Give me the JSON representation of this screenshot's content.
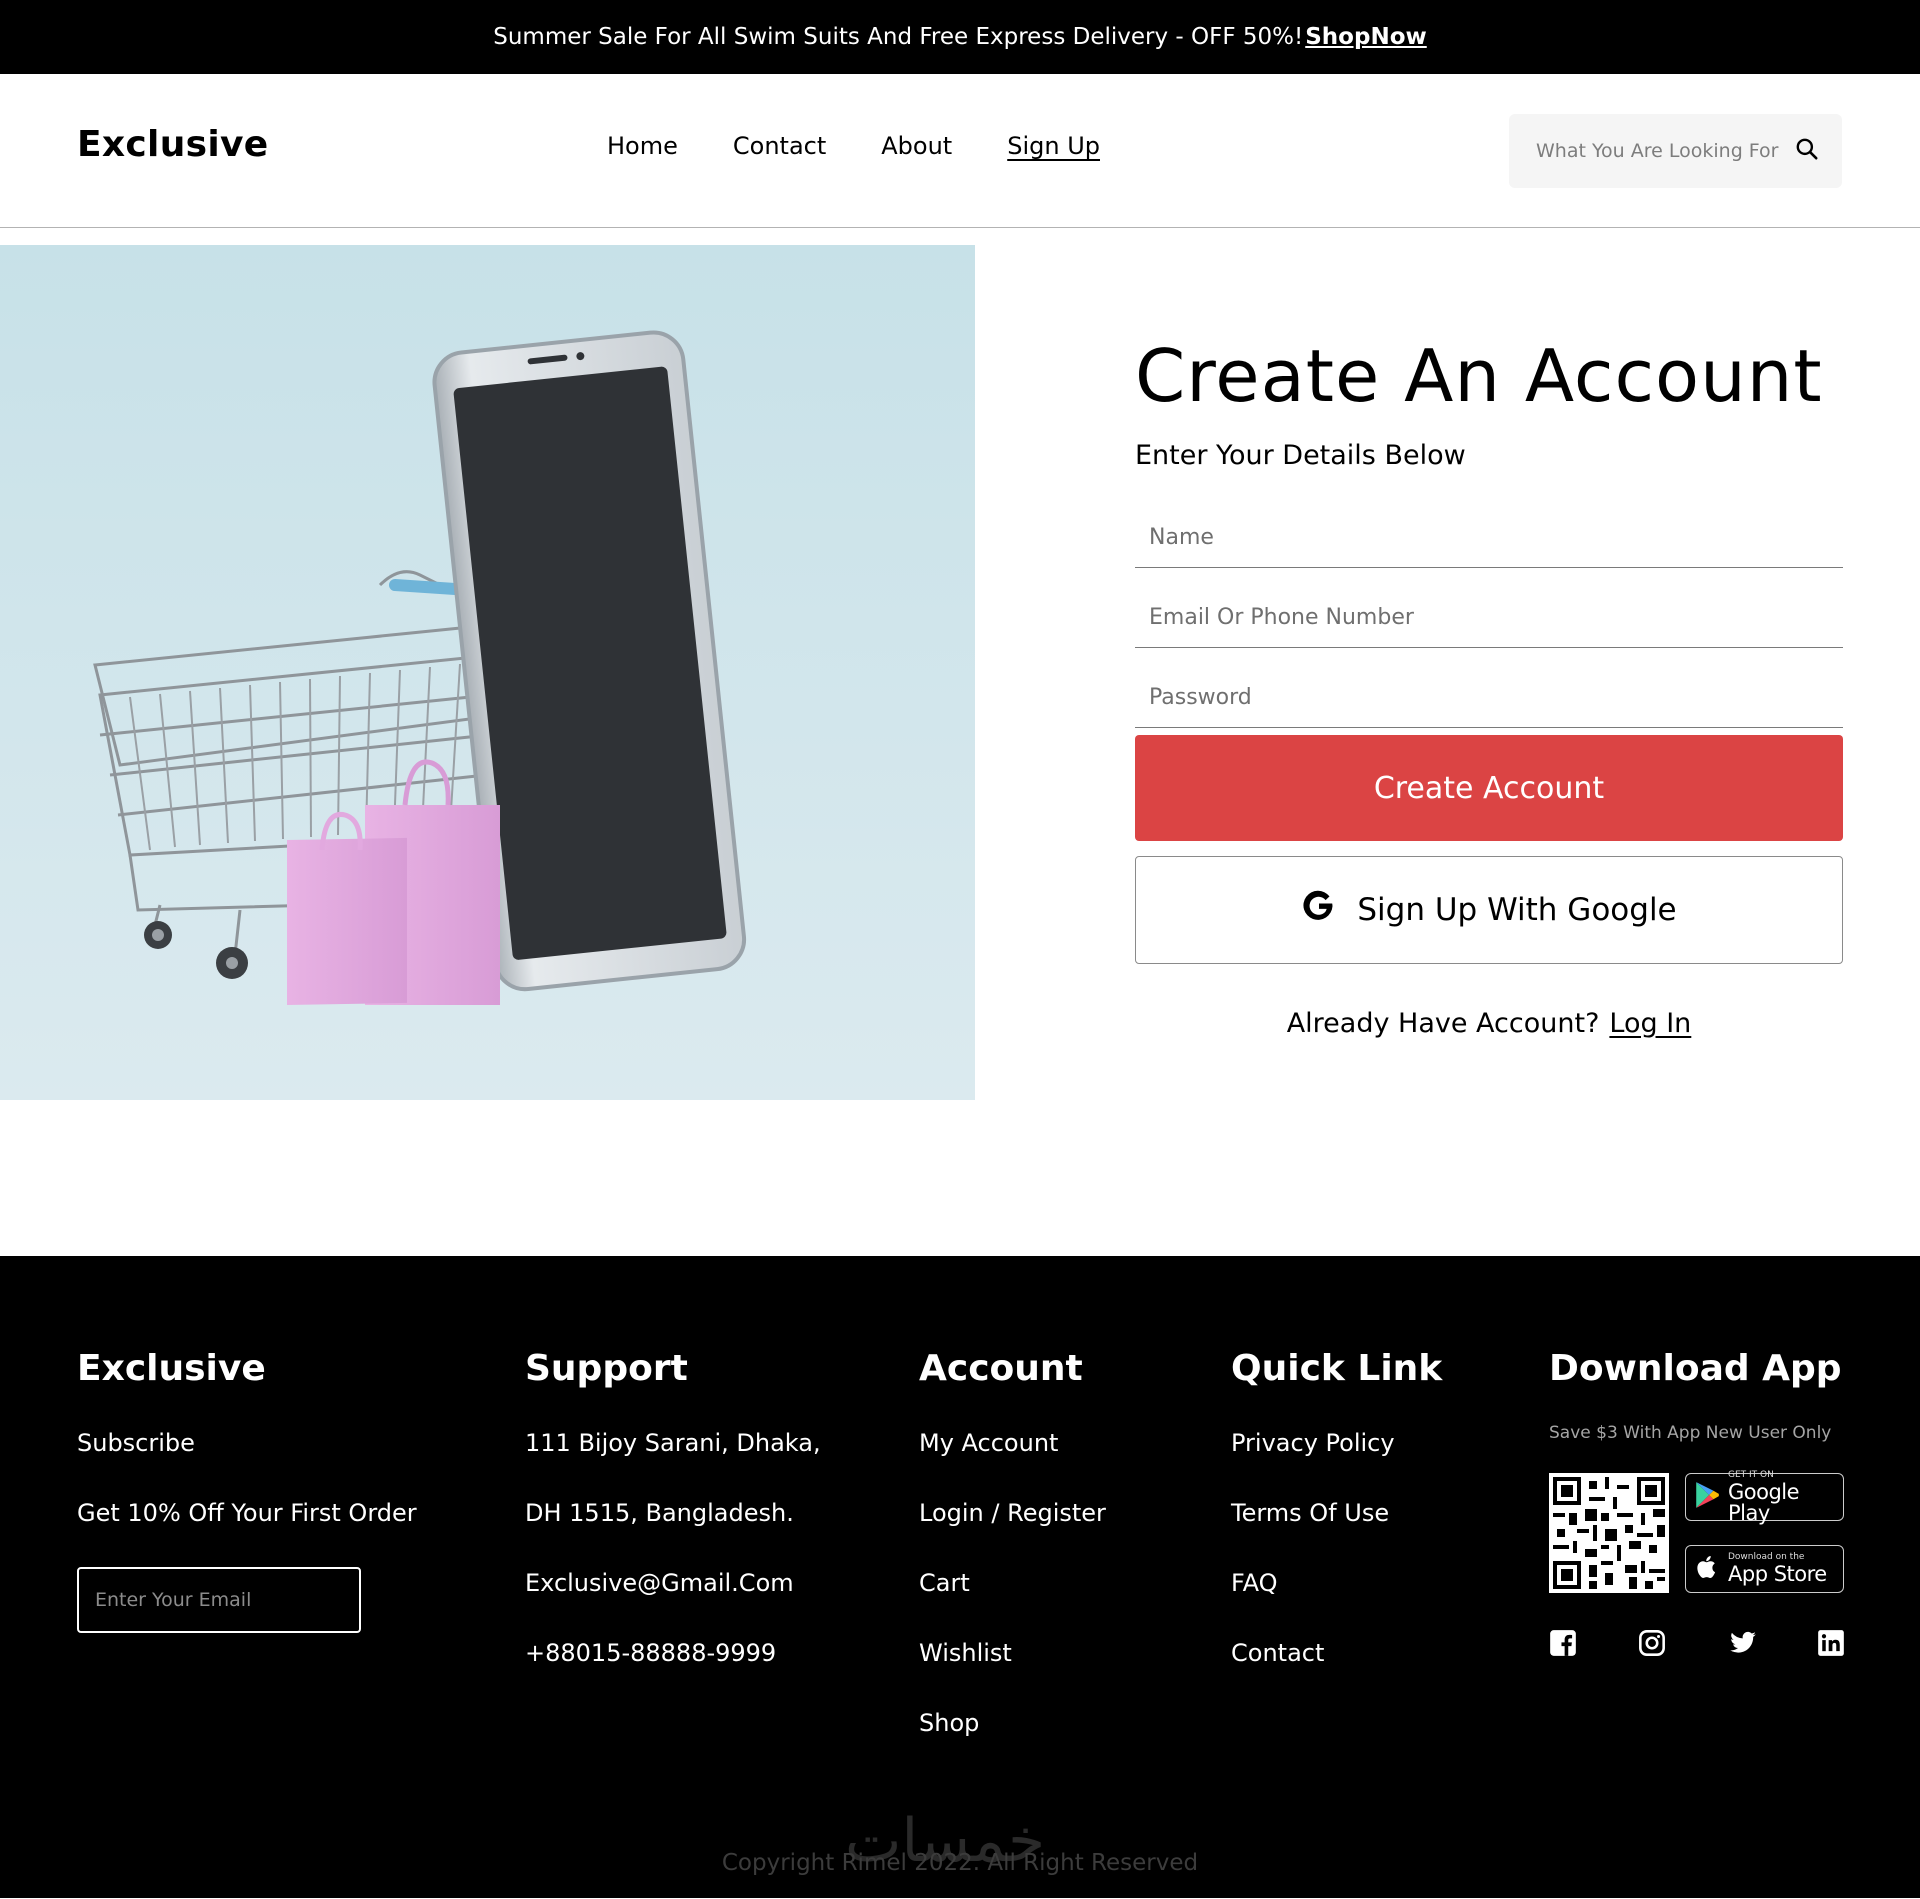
{
  "topbar": {
    "text": "Summer Sale For All Swim Suits And Free Express Delivery - OFF 50%!",
    "link": "ShopNow"
  },
  "header": {
    "logo": "Exclusive",
    "nav": [
      "Home",
      "Contact",
      "About",
      "Sign Up"
    ],
    "active_nav": "Sign Up",
    "search_placeholder": "What You Are Looking For"
  },
  "form": {
    "title": "Create An Account",
    "subtitle": "Enter Your Details Below",
    "name_placeholder": "Name",
    "email_placeholder": "Email Or Phone Number",
    "password_placeholder": "Password",
    "create_button": "Create Account",
    "google_button": "Sign Up With Google",
    "login_prompt": "Already Have Account?",
    "login_link": "Log In"
  },
  "footer": {
    "col1": {
      "title": "Exclusive",
      "subscribe": "Subscribe",
      "offer": "Get 10% Off Your First Order",
      "email_placeholder": "Enter Your Email"
    },
    "support": {
      "title": "Support",
      "lines": [
        "111 Bijoy Sarani, Dhaka,",
        "DH 1515, Bangladesh.",
        "Exclusive@Gmail.Com",
        "+88015-88888-9999"
      ]
    },
    "account": {
      "title": "Account",
      "links": [
        "My Account",
        "Login / Register",
        "Cart",
        "Wishlist",
        "Shop"
      ]
    },
    "quick": {
      "title": "Quick Link",
      "links": [
        "Privacy Policy",
        "Terms Of Use",
        "FAQ",
        "Contact"
      ]
    },
    "app": {
      "title": "Download App",
      "note": "Save $3 With App New User Only",
      "google_play_small": "GET IT ON",
      "google_play_big": "Google Play",
      "app_store_small": "Download on the",
      "app_store_big": "App Store"
    },
    "socials": [
      "facebook-icon",
      "instagram-icon",
      "twitter-icon",
      "linkedin-icon"
    ],
    "copyright": "Copyright Rimel 2022. All Right Reserved",
    "watermark": "خمسات"
  },
  "colors": {
    "accent": "#DB4444",
    "hero_bg": "#C9E2E9",
    "footer_bg": "#000000"
  }
}
